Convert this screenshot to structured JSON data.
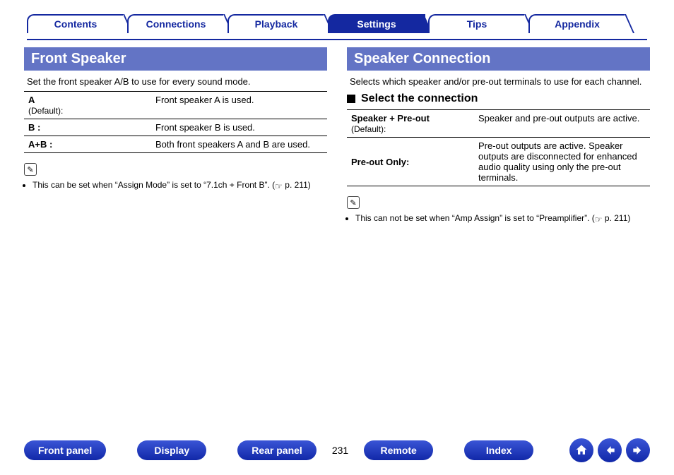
{
  "tabs": {
    "contents": "Contents",
    "connections": "Connections",
    "playback": "Playback",
    "settings": "Settings",
    "tips": "Tips",
    "appendix": "Appendix"
  },
  "left": {
    "title": "Front Speaker",
    "intro": "Set the front speaker A/B to use for every sound mode.",
    "rows": [
      {
        "key": "A",
        "default": "(Default):",
        "val": "Front speaker A is used."
      },
      {
        "key": "B :",
        "default": "",
        "val": "Front speaker B is used."
      },
      {
        "key": "A+B :",
        "default": "",
        "val": "Both front speakers A and B are used."
      }
    ],
    "note_pre": "This can be set when “Assign Mode” is set to “7.1ch + Front B”.  (",
    "note_link": "p. 211",
    "note_post": ")"
  },
  "right": {
    "title": "Speaker Connection",
    "intro": "Selects which speaker and/or pre-out terminals to use for each channel.",
    "subhead": "Select the connection",
    "rows": [
      {
        "key": "Speaker + Pre-out",
        "default": "(Default):",
        "val": "Speaker and pre-out outputs are active."
      },
      {
        "key": "Pre-out Only:",
        "default": "",
        "val": "Pre-out outputs are active. Speaker outputs are disconnected for enhanced audio quality using only the pre-out terminals."
      }
    ],
    "note_pre": "This can not be set when “Amp Assign” is set to “Preamplifier”.  (",
    "note_link": "p. 211",
    "note_post": ")"
  },
  "bottom": {
    "front_panel": "Front panel",
    "display": "Display",
    "rear_panel": "Rear panel",
    "page": "231",
    "remote": "Remote",
    "index": "Index"
  }
}
